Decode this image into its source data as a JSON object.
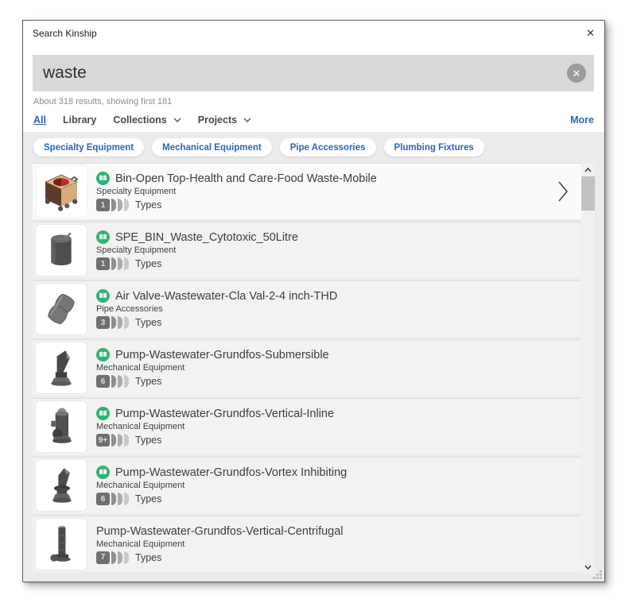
{
  "window": {
    "title": "Search Kinship",
    "close_glyph": "✕"
  },
  "search": {
    "value": "waste",
    "results_info": "About 318 results, showing first 181"
  },
  "tabs": {
    "all": "All",
    "library": "Library",
    "collections": "Collections",
    "projects": "Projects",
    "more": "More"
  },
  "filters": [
    "Specialty Equipment",
    "Mechanical Equipment",
    "Pipe Accessories",
    "Plumbing Fixtures"
  ],
  "results": {
    "types_label": "Types",
    "items": [
      {
        "title": "Bin-Open Top-Health and Care-Food Waste-Mobile",
        "category": "Specialty Equipment",
        "types_count": "1"
      },
      {
        "title": "SPE_BIN_Waste_Cytotoxic_50Litre",
        "category": "Specialty Equipment",
        "types_count": "1"
      },
      {
        "title": "Air Valve-Wastewater-Cla Val-2-4 inch-THD",
        "category": "Pipe Accessories",
        "types_count": "3"
      },
      {
        "title": "Pump-Wastewater-Grundfos-Submersible",
        "category": "Mechanical Equipment",
        "types_count": "6"
      },
      {
        "title": "Pump-Wastewater-Grundfos-Vertical-Inline",
        "category": "Mechanical Equipment",
        "types_count": "9+"
      },
      {
        "title": "Pump-Wastewater-Grundfos-Vortex Inhibiting",
        "category": "Mechanical Equipment",
        "types_count": "6"
      },
      {
        "title": "Pump-Wastewater-Grundfos-Vertical-Centrifugal",
        "category": "Mechanical Equipment",
        "types_count": "7"
      }
    ]
  },
  "colors": {
    "accent_blue": "#2a64c8",
    "badge_green": "#2cb573",
    "search_bg": "#d9d9d9",
    "section_gray": "#ebebeb"
  }
}
